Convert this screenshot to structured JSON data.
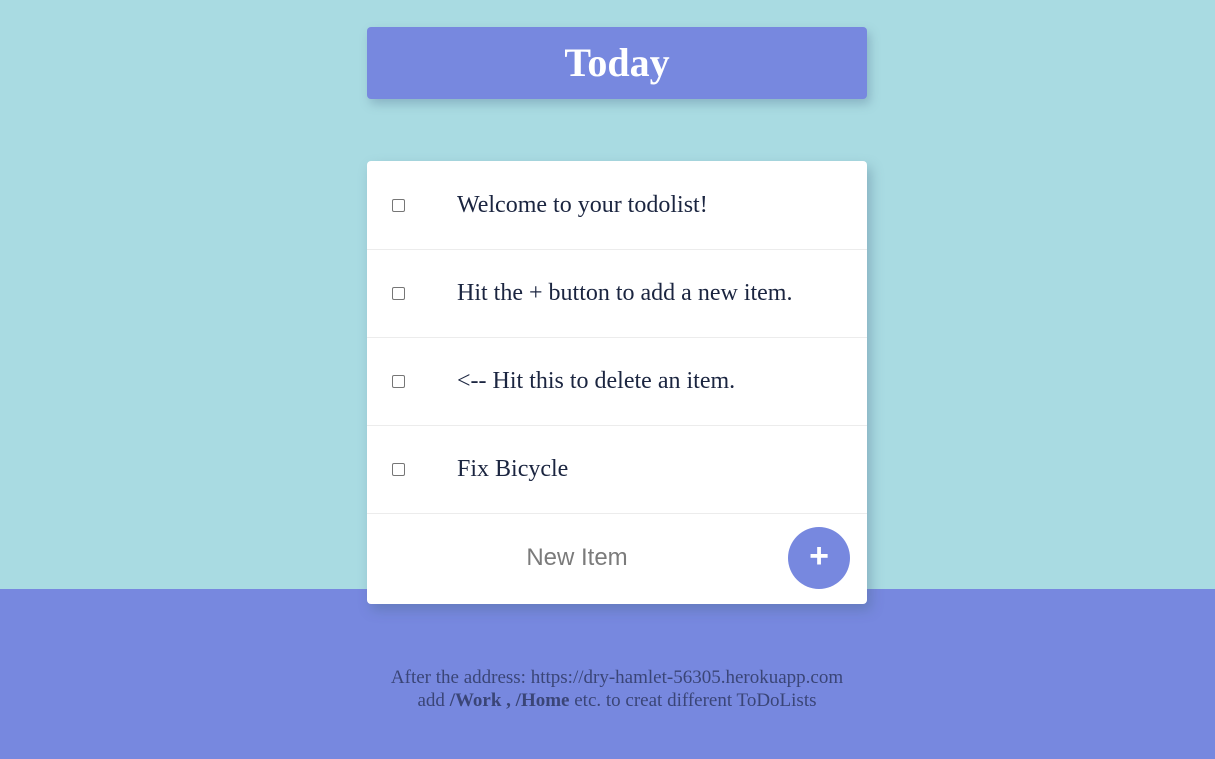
{
  "header": {
    "title": "Today"
  },
  "list": {
    "items": [
      {
        "text": "Welcome to your todolist!",
        "checked": false
      },
      {
        "text": "Hit the + button to add a new item.",
        "checked": false
      },
      {
        "text": "<-- Hit this to delete an item.",
        "checked": false
      },
      {
        "text": "Fix Bicycle",
        "checked": false
      }
    ]
  },
  "new_item": {
    "placeholder": "New Item",
    "value": "",
    "add_label": "+"
  },
  "footer": {
    "line1": "After the address: https://dry-hamlet-56305.herokuapp.com",
    "line2_prefix": "add",
    "line2_bold": "/Work , /Home",
    "line2_suffix": "etc. to creat different ToDoLists"
  },
  "colors": {
    "background": "#a9dbe2",
    "accent": "#7788df",
    "card": "#ffffff",
    "item_text": "#1b2540",
    "footer_text": "#3a4577"
  }
}
